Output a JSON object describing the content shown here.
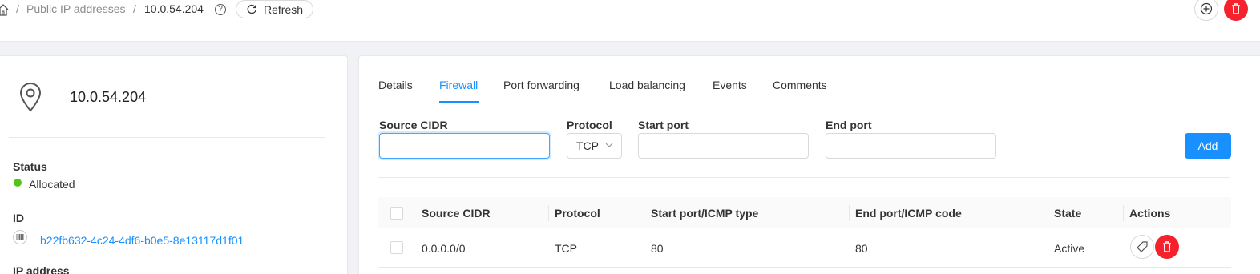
{
  "header": {
    "breadcrumb": {
      "sep": "/",
      "parent": "Public IP addresses",
      "current": "10.0.54.204"
    },
    "refresh_label": "Refresh",
    "help_glyph": "?"
  },
  "summary": {
    "title": "10.0.54.204",
    "status_label": "Status",
    "status_value": "Allocated",
    "status_color": "#52c41a",
    "id_label": "ID",
    "id_value": "b22fb632-4c24-4df6-b0e5-8e13117d1f01",
    "next_label": "IP address"
  },
  "tabs": [
    {
      "label": "Details",
      "active": false
    },
    {
      "label": "Firewall",
      "active": true
    },
    {
      "label": "Port forwarding",
      "active": false
    },
    {
      "label": "Load balancing",
      "active": false
    },
    {
      "label": "Events",
      "active": false
    },
    {
      "label": "Comments",
      "active": false
    }
  ],
  "form": {
    "source_cidr_label": "Source CIDR",
    "source_cidr_value": "",
    "protocol_label": "Protocol",
    "protocol_value": "TCP",
    "start_port_label": "Start port",
    "start_port_value": "",
    "end_port_label": "End port",
    "end_port_value": "",
    "add_label": "Add"
  },
  "table": {
    "columns": [
      "Source CIDR",
      "Protocol",
      "Start port/ICMP type",
      "End port/ICMP code",
      "State",
      "Actions"
    ],
    "rows": [
      {
        "source_cidr": "0.0.0.0/0",
        "protocol": "TCP",
        "start": "80",
        "end": "80",
        "state": "Active"
      }
    ]
  },
  "colors": {
    "accent": "#1890ff",
    "danger": "#f5222d",
    "success": "#52c41a"
  },
  "icons": [
    "home-icon",
    "help-icon",
    "refresh-icon",
    "plus-circle-icon",
    "trash-icon",
    "location-pin-icon",
    "barcode-icon",
    "chevron-down-icon",
    "tag-icon"
  ]
}
